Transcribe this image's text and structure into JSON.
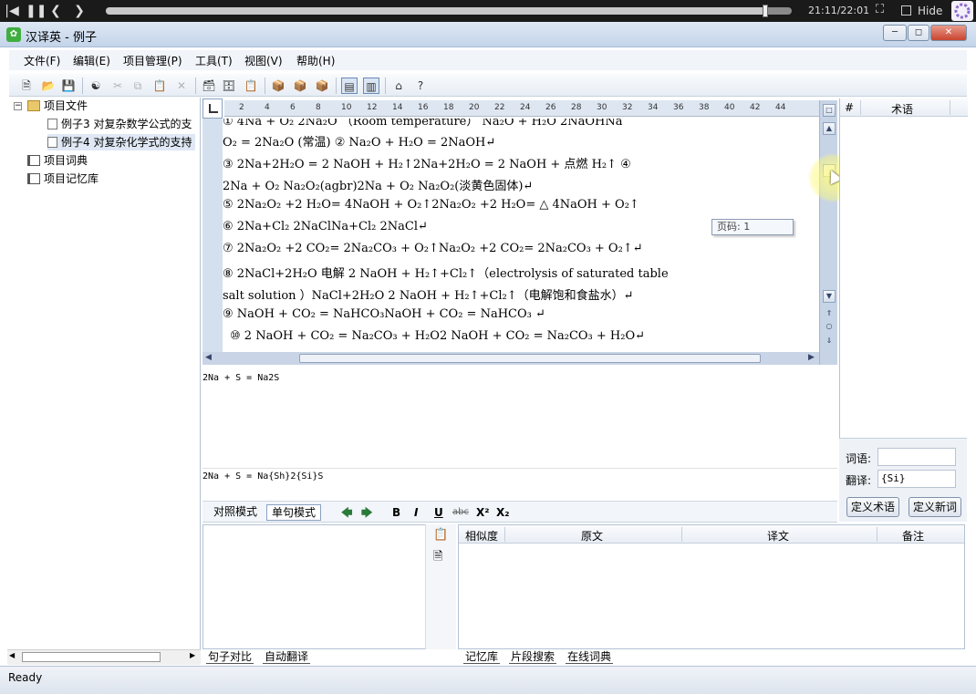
{
  "player": {
    "time": "21:11/22:01",
    "hide_label": "Hide",
    "progress_fraction": 0.962
  },
  "window": {
    "title": "汉译英 - 例子"
  },
  "menu": [
    "文件(F)",
    "编辑(E)",
    "项目管理(P)",
    "工具(T)",
    "视图(V)",
    "帮助(H)"
  ],
  "toolbar": {
    "icons": [
      "new-file-icon",
      "open-folder-icon",
      "save-icon",
      "find-binoculars-icon",
      "cut-icon",
      "copy-icon",
      "paste-icon",
      "delete-icon",
      "project-add-icon",
      "project-import-icon",
      "project-export-icon",
      "memory-icon",
      "memory-disabled-icon",
      "memory-disabled-icon-2",
      "view-split-icon",
      "view-single-icon",
      "home-icon",
      "help-icon"
    ]
  },
  "tree": {
    "items": [
      {
        "label": "项目文件"
      },
      {
        "label": "例子3  对复杂数学公式的支"
      },
      {
        "label": "例子4  对复杂化学式的支持"
      },
      {
        "label": "项目词典"
      },
      {
        "label": "项目记忆库"
      }
    ]
  },
  "ruler": {
    "ticks": [
      "2",
      "4",
      "6",
      "8",
      "10",
      "12",
      "14",
      "16",
      "18",
      "20",
      "22",
      "24",
      "26",
      "28",
      "30",
      "32",
      "34",
      "36",
      "38",
      "40",
      "42",
      "44"
    ]
  },
  "document": {
    "lines": [
      "①  4Na  +  O₂        2Na₂O  （Room temperature）            Na₂O + H₂O        2NaOHNa",
      "O₂  =    2Na₂O  (常温)            ②  Na₂O + H₂O   =   2NaOH↵",
      "③   2Na+2H₂O  =  2 NaOH  +  H₂↑2Na+2H₂O  =  2 NaOH  +       点燃             H₂↑              ④",
      "2Na + O₂              Na₂O₂(agbr)2Na + O₂              Na₂O₂(淡黄色固体)↵",
      "⑤   2Na₂O₂  +2  H₂O=  4NaOH  +  O₂↑2Na₂O₂  +2  H₂O=    △                  4NaOH + O₂↑",
      "⑥ 2Na+Cl₂             2NaClNa+Cl₂              2NaCl↵",
      "⑦ 2Na₂O₂ +2 CO₂= 2Na₂CO₃ + O₂↑Na₂O₂ +2 CO₂= 2Na₂CO₃ + O₂↑↵",
      "⑧      2NaCl+2H₂O     电解      2  NaOH  +  H₂↑+Cl₂↑（electrolysis of saturated table",
      "salt solution ）NaCl+2H₂O        2 NaOH + H₂↑+Cl₂↑（电解饱和食盐水）↵",
      "⑨  NaOH + CO₂ = NaHCO₃NaOH + CO₂ = NaHCO₃          ↵",
      "⑩   2 NaOH + CO₂ = Na₂CO₃ + H₂O2 NaOH + CO₂ = Na₂CO₃ + H₂O↵"
    ],
    "tooltip": "页码: 1"
  },
  "source_text": "2Na + S = Na2S",
  "target_text": "2Na  +  S  =  Na{Sh}2{Si}S",
  "modebar": {
    "compare_mode": "对照模式",
    "single_mode": "单句模式",
    "bold": "B",
    "italic": "I",
    "underline": "U",
    "strike": "abc",
    "sup": "X²",
    "sub": "X₂"
  },
  "term_panel": {
    "col_num": "#",
    "col_term": "术语",
    "word_label": "词语:",
    "word_value": "",
    "translation_label": "翻译:",
    "translation_value": "{Si}",
    "define_term": "定义术语",
    "define_word": "定义新词"
  },
  "memory_table": {
    "columns": [
      "相似度",
      "原文",
      "译文",
      "备注"
    ]
  },
  "tabs_left": [
    "句子对比",
    "自动翻译"
  ],
  "tabs_right": [
    "记忆库",
    "片段搜索",
    "在线词典"
  ],
  "status": "Ready"
}
